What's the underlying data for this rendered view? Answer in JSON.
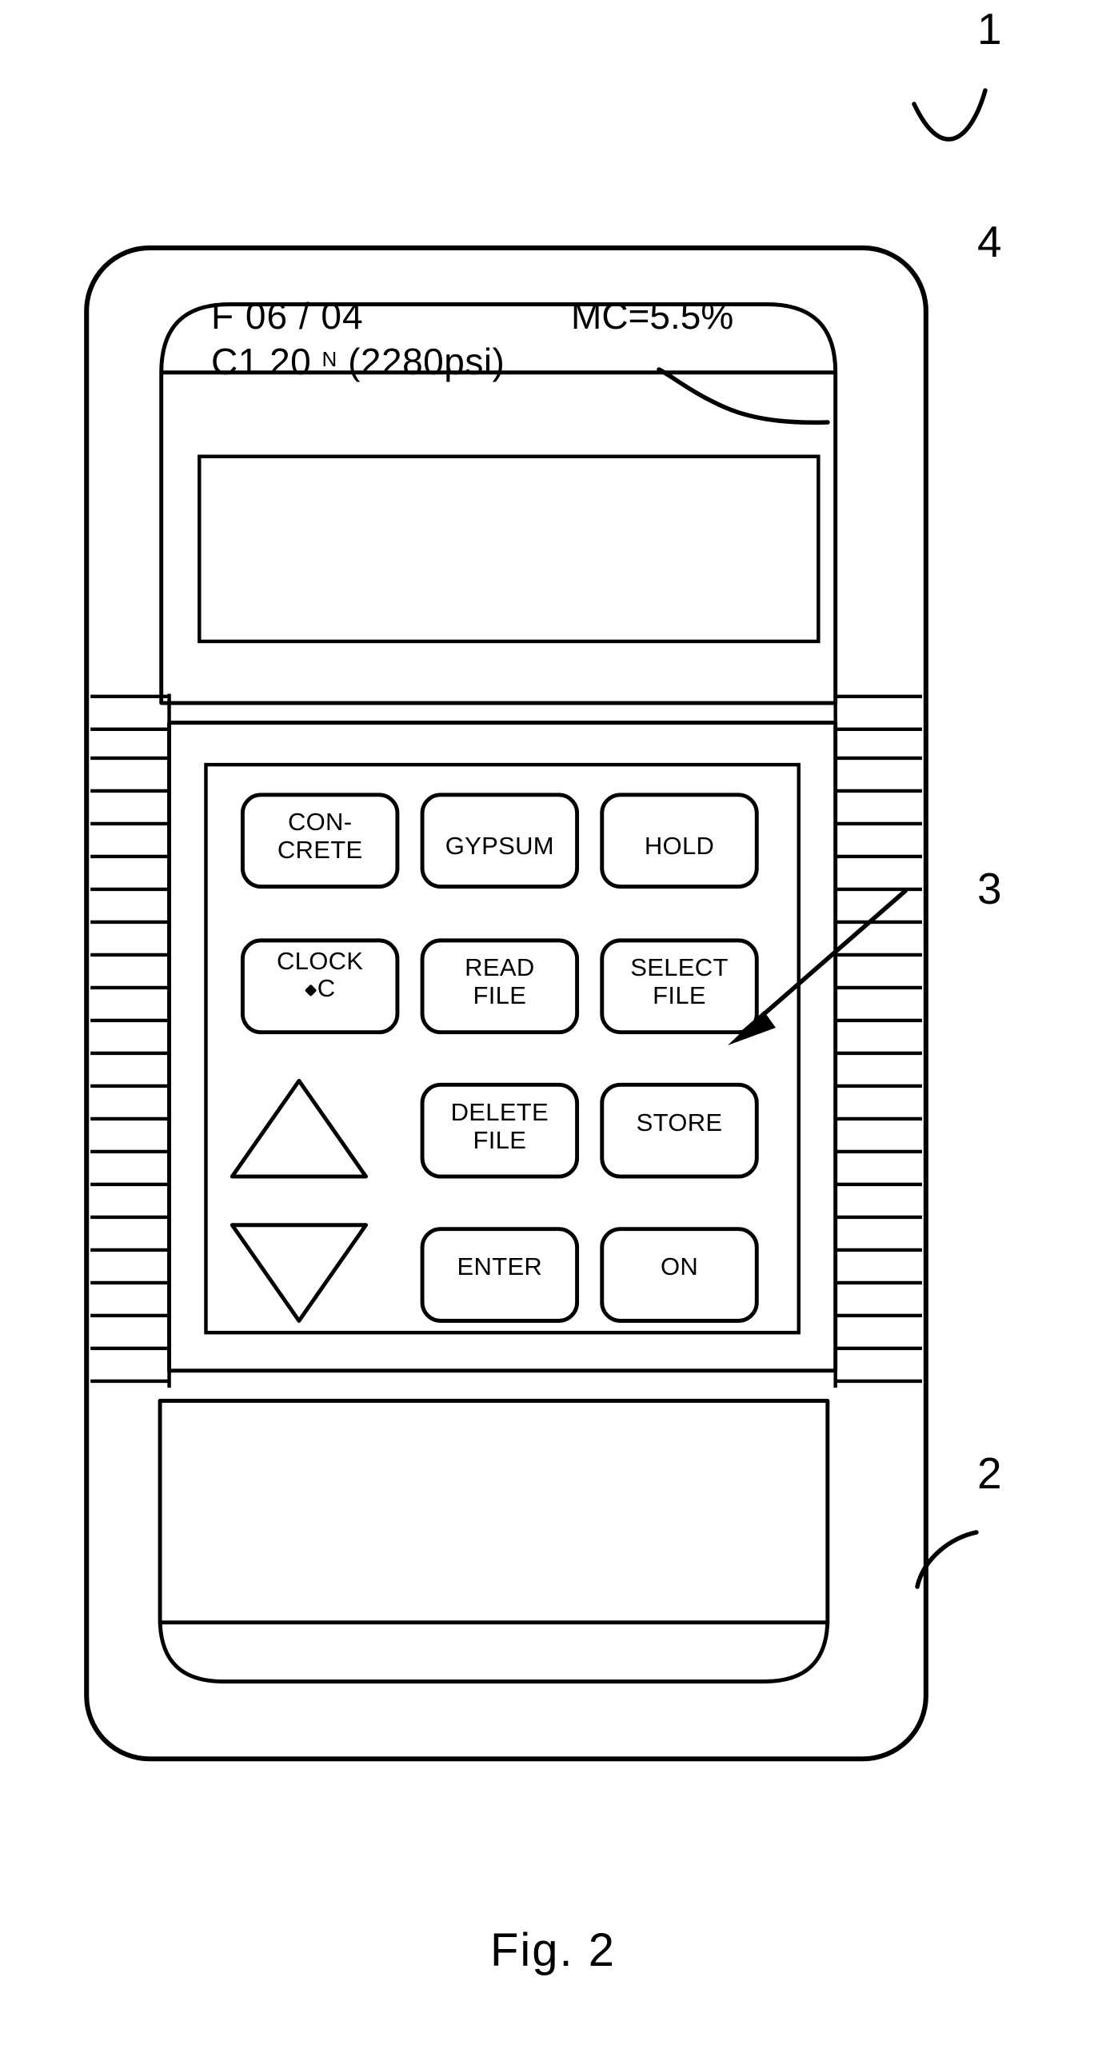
{
  "figure": {
    "caption": "Fig. 2",
    "reference_numerals": [
      {
        "id": "1",
        "label": "1",
        "target": "device-overall"
      },
      {
        "id": "2",
        "label": "2",
        "target": "device-housing"
      },
      {
        "id": "3",
        "label": "3",
        "target": "keypad"
      },
      {
        "id": "4",
        "label": "4",
        "target": "lcd-display"
      }
    ]
  },
  "device": {
    "display": {
      "line1_left": "F 06 / 04",
      "line1_right": "MC=5.5%",
      "line2_prefix": "C1 20 ",
      "line2_superscript": "N",
      "line2_suffix": " (2280psi)"
    },
    "keypad": {
      "rows": [
        [
          {
            "name": "concrete",
            "label": "CON-\nCRETE",
            "shape": "key"
          },
          {
            "name": "gypsum",
            "label": "GYPSUM",
            "shape": "key"
          },
          {
            "name": "hold",
            "label": "HOLD",
            "shape": "key"
          }
        ],
        [
          {
            "name": "clock",
            "label": "CLOCK",
            "sublabel": "C",
            "degree": true,
            "shape": "key"
          },
          {
            "name": "read-file",
            "label": "READ\nFILE",
            "shape": "key"
          },
          {
            "name": "select-file",
            "label": "SELECT\nFILE",
            "shape": "key"
          }
        ],
        [
          {
            "name": "up-arrow",
            "label": "",
            "shape": "triangle-up"
          },
          {
            "name": "delete-file",
            "label": "DELETE\nFILE",
            "shape": "key"
          },
          {
            "name": "store",
            "label": "STORE",
            "shape": "key"
          }
        ],
        [
          {
            "name": "down-arrow",
            "label": "",
            "shape": "triangle-down"
          },
          {
            "name": "enter",
            "label": "ENTER",
            "shape": "key"
          },
          {
            "name": "on",
            "label": "ON",
            "shape": "key"
          }
        ]
      ]
    }
  },
  "colors": {
    "ink": "#000000",
    "paper": "#ffffff"
  }
}
